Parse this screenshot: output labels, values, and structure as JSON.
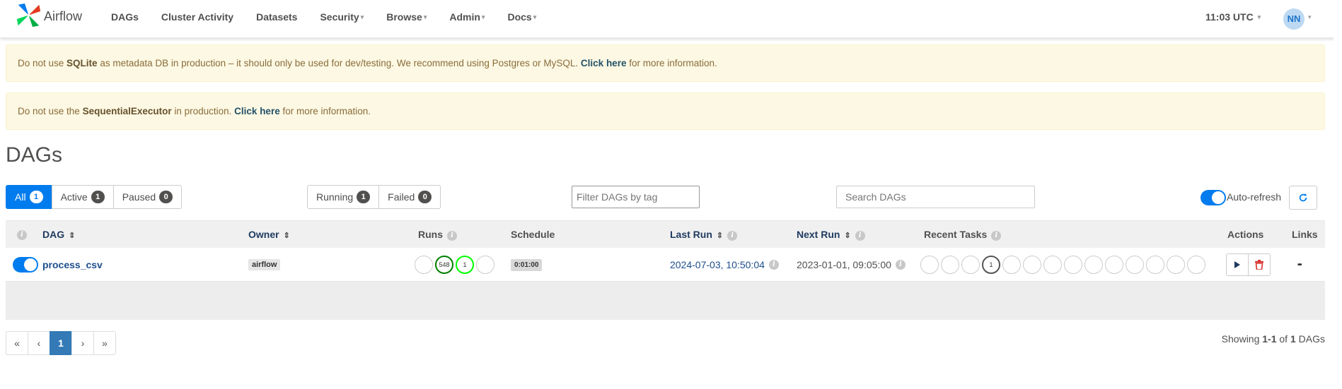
{
  "navbar": {
    "brand": "Airflow",
    "items": [
      {
        "label": "DAGs",
        "caret": false
      },
      {
        "label": "Cluster Activity",
        "caret": false
      },
      {
        "label": "Datasets",
        "caret": false
      },
      {
        "label": "Security",
        "caret": true
      },
      {
        "label": "Browse",
        "caret": true
      },
      {
        "label": "Admin",
        "caret": true
      },
      {
        "label": "Docs",
        "caret": true
      }
    ],
    "time": "11:03 UTC",
    "avatar": "NN",
    "caret_glyph": "▾"
  },
  "alerts": {
    "sqlite": {
      "pre": "Do not use ",
      "strong": "SQLite",
      "mid": " as metadata DB in production – it should only be used for dev/testing. We recommend using Postgres or MySQL. ",
      "link": "Click here",
      "post": " for more information."
    },
    "executor": {
      "pre": "Do not use the ",
      "strong": "SequentialExecutor",
      "mid": " in production. ",
      "link": "Click here",
      "post": " for more information."
    }
  },
  "page_title": "DAGs",
  "filters": {
    "status": [
      {
        "label": "All",
        "count": "1",
        "active": true
      },
      {
        "label": "Active",
        "count": "1",
        "active": false
      },
      {
        "label": "Paused",
        "count": "0",
        "active": false
      }
    ],
    "state": [
      {
        "label": "Running",
        "count": "1"
      },
      {
        "label": "Failed",
        "count": "0"
      }
    ],
    "tag_placeholder": "Filter DAGs by tag",
    "search_placeholder": "Search DAGs",
    "auto_refresh_label": "Auto-refresh"
  },
  "table": {
    "headers": {
      "dag": "DAG",
      "owner": "Owner",
      "runs": "Runs",
      "schedule": "Schedule",
      "last_run": "Last Run",
      "next_run": "Next Run",
      "recent_tasks": "Recent Tasks",
      "actions": "Actions",
      "links": "Links"
    },
    "rows": [
      {
        "dag_id": "process_csv",
        "owner": "airflow",
        "runs": [
          "",
          "548",
          "1",
          ""
        ],
        "schedule": "0:01:00",
        "last_run": "2024-07-03, 10:50:04",
        "next_run": "2023-01-01, 09:05:00",
        "recent_tasks": [
          "",
          "",
          "",
          "1",
          "",
          "",
          "",
          "",
          "",
          "",
          "",
          "",
          "",
          ""
        ],
        "links_glyph": "•••"
      }
    ]
  },
  "pagination": {
    "first": "«",
    "prev": "‹",
    "current": "1",
    "next": "›",
    "last": "»"
  },
  "showing": {
    "pre": "Showing ",
    "range": "1-1",
    "of": " of ",
    "total": "1",
    "post": " DAGs"
  },
  "colors": {
    "accent": "#017cee",
    "success": "#008000",
    "running": "#00ff00",
    "alert_bg": "#fcf8e3"
  }
}
